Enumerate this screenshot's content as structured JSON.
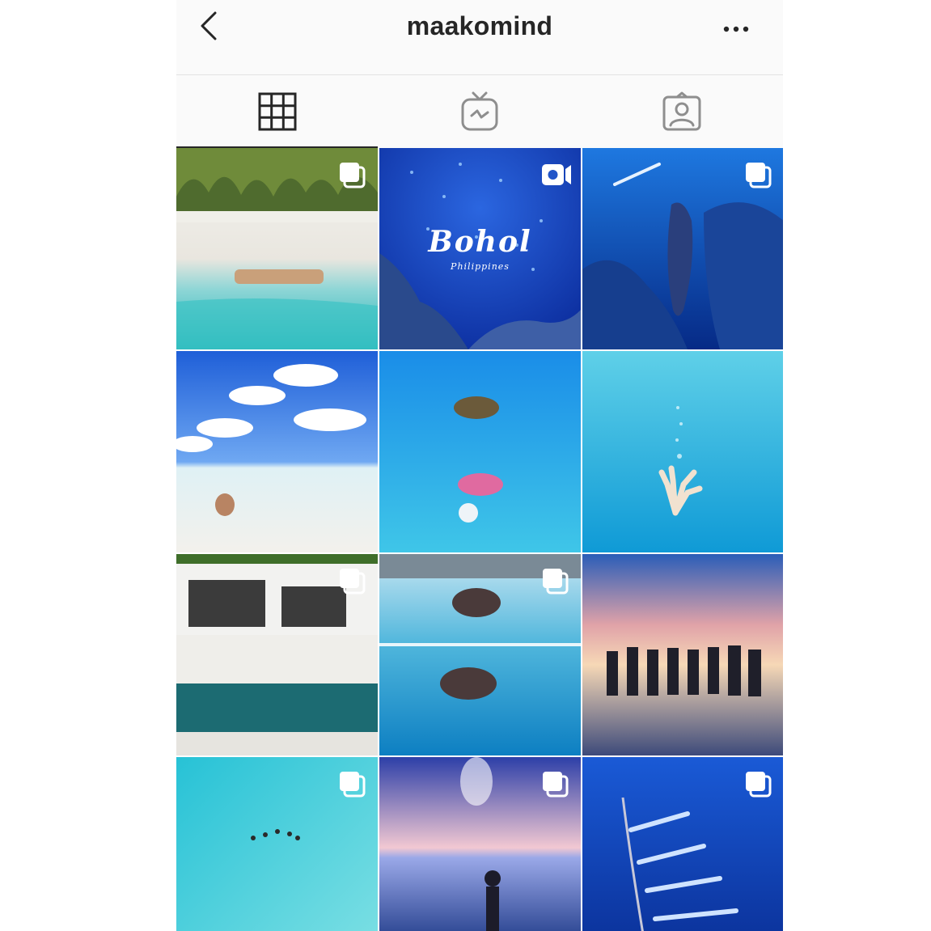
{
  "header": {
    "title": "maakomind",
    "back_icon": "chevron-left-icon",
    "more_icon": "more-horizontal-icon"
  },
  "tabs": [
    {
      "name": "grid",
      "icon": "grid-icon",
      "active": true
    },
    {
      "name": "igtv",
      "icon": "igtv-icon",
      "active": false
    },
    {
      "name": "tagged",
      "icon": "tagged-user-icon",
      "active": false
    }
  ],
  "posts": [
    {
      "id": "post-1",
      "badge": "carousel"
    },
    {
      "id": "post-2",
      "badge": "video",
      "overlay_title": "Bohol",
      "overlay_subtitle": "Philippines"
    },
    {
      "id": "post-3",
      "badge": "carousel"
    },
    {
      "id": "post-4",
      "badge": "none"
    },
    {
      "id": "post-5",
      "badge": "none"
    },
    {
      "id": "post-6",
      "badge": "none"
    },
    {
      "id": "post-7",
      "badge": "carousel"
    },
    {
      "id": "post-8",
      "badge": "carousel"
    },
    {
      "id": "post-9",
      "badge": "none"
    },
    {
      "id": "post-10",
      "badge": "carousel"
    },
    {
      "id": "post-11",
      "badge": "carousel"
    },
    {
      "id": "post-12",
      "badge": "carousel"
    }
  ],
  "colors": {
    "text": "#262626",
    "header_bg": "#fafafa",
    "divider": "#e3e3e3"
  }
}
